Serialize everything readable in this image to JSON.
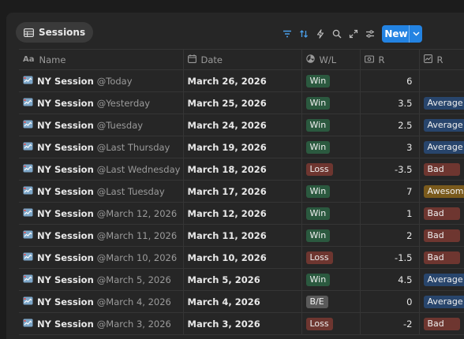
{
  "view": {
    "icon": "table-icon",
    "label": "Sessions"
  },
  "toolbar": {
    "icons": [
      "filter-icon",
      "sort-icon",
      "lightning-icon",
      "search-icon",
      "expand-icon",
      "settings-sliders-icon"
    ],
    "new_label": "New",
    "accent": "#2383e2"
  },
  "columns": [
    {
      "icon": "text-aa-icon",
      "label": "Name"
    },
    {
      "icon": "calendar-icon",
      "label": "Date"
    },
    {
      "icon": "status-icon",
      "label": "W/L"
    },
    {
      "icon": "money-icon",
      "label": "R"
    },
    {
      "icon": "chart-icon",
      "label": "R"
    }
  ],
  "rows": [
    {
      "icon": "session-icon",
      "name": "NY Session",
      "mention": "@Today",
      "date": "March 26, 2026",
      "wl": "Win",
      "r": "6",
      "rating": ""
    },
    {
      "icon": "session-icon",
      "name": "NY Session",
      "mention": "@Yesterday",
      "date": "March 25, 2026",
      "wl": "Win",
      "r": "3.5",
      "rating": "Average"
    },
    {
      "icon": "session-icon",
      "name": "NY Session",
      "mention": "@Tuesday",
      "date": "March 24, 2026",
      "wl": "Win",
      "r": "2.5",
      "rating": "Average"
    },
    {
      "icon": "session-icon",
      "name": "NY Session",
      "mention": "@Last Thursday",
      "date": "March 19, 2026",
      "wl": "Win",
      "r": "3",
      "rating": "Average"
    },
    {
      "icon": "session-icon",
      "name": "NY Session",
      "mention": "@Last Wednesday",
      "date": "March 18, 2026",
      "wl": "Loss",
      "r": "-3.5",
      "rating": "Bad"
    },
    {
      "icon": "session-icon",
      "name": "NY Session",
      "mention": "@Last Tuesday",
      "date": "March 17, 2026",
      "wl": "Win",
      "r": "7",
      "rating": "Awesome"
    },
    {
      "icon": "session-icon",
      "name": "NY Session",
      "mention": "@March 12, 2026",
      "date": "March 12, 2026",
      "wl": "Win",
      "r": "1",
      "rating": "Bad"
    },
    {
      "icon": "session-icon",
      "name": "NY Session",
      "mention": "@March 11, 2026",
      "date": "March 11, 2026",
      "wl": "Win",
      "r": "2",
      "rating": "Bad"
    },
    {
      "icon": "session-icon",
      "name": "NY Session",
      "mention": "@March 10, 2026",
      "date": "March 10, 2026",
      "wl": "Loss",
      "r": "-1.5",
      "rating": "Bad"
    },
    {
      "icon": "session-icon",
      "name": "NY Session",
      "mention": "@March 5, 2026",
      "date": "March 5, 2026",
      "wl": "Win",
      "r": "4.5",
      "rating": "Average"
    },
    {
      "icon": "session-icon",
      "name": "NY Session",
      "mention": "@March 4, 2026",
      "date": "March 4, 2026",
      "wl": "B/E",
      "r": "0",
      "rating": "Average"
    },
    {
      "icon": "session-icon",
      "name": "NY Session",
      "mention": "@March 3, 2026",
      "date": "March 3, 2026",
      "wl": "Loss",
      "r": "-2",
      "rating": "Bad"
    }
  ]
}
